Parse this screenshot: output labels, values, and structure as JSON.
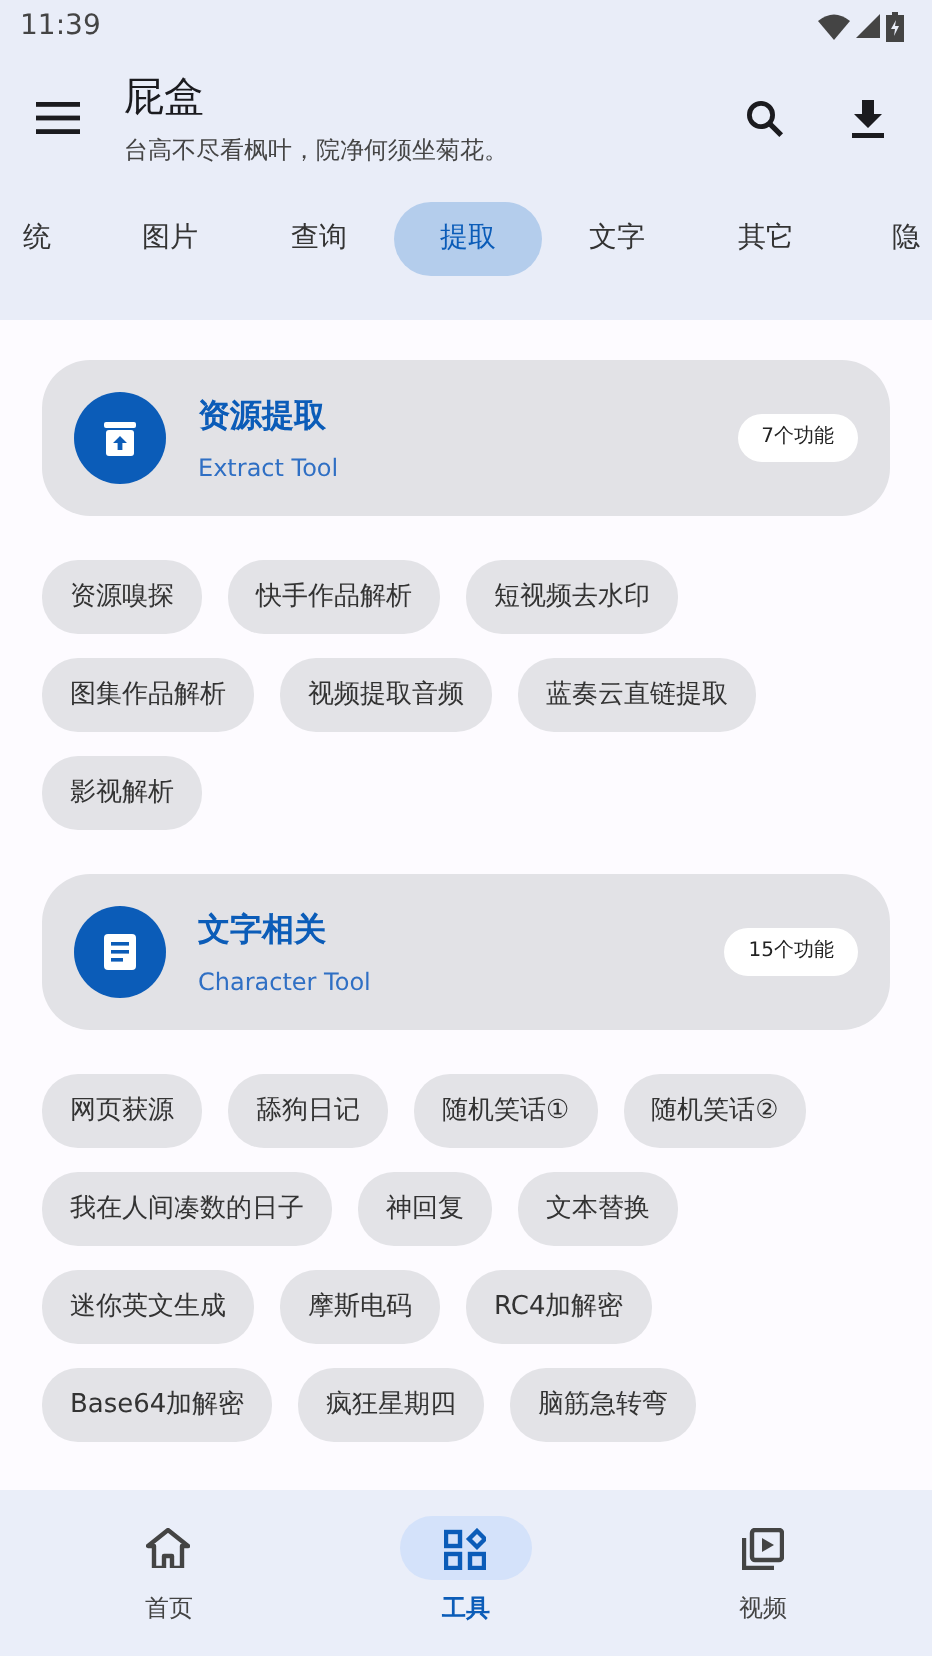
{
  "status_bar": {
    "time": "11:39"
  },
  "header": {
    "title": "屁盒",
    "subtitle": "台高不尽看枫叶，院净何须坐菊花。"
  },
  "tabs": [
    {
      "label": "统",
      "selected": false
    },
    {
      "label": "图片",
      "selected": false
    },
    {
      "label": "查询",
      "selected": false
    },
    {
      "label": "提取",
      "selected": true
    },
    {
      "label": "文字",
      "selected": false
    },
    {
      "label": "其它",
      "selected": false
    },
    {
      "label": "隐",
      "selected": false
    }
  ],
  "sections": [
    {
      "title": "资源提取",
      "subtitle": "Extract Tool",
      "count": "7个功能",
      "tools": [
        "资源嗅探",
        "快手作品解析",
        "短视频去水印",
        "图集作品解析",
        "视频提取音频",
        "蓝奏云直链提取",
        "影视解析"
      ]
    },
    {
      "title": "文字相关",
      "subtitle": "Character Tool",
      "count": "15个功能",
      "tools": [
        "网页获源",
        "舔狗日记",
        "随机笑话①",
        "随机笑话②",
        "我在人间凑数的日子",
        "神回复",
        "文本替换",
        "迷你英文生成",
        "摩斯电码",
        "RC4加解密",
        "Base64加解密",
        "疯狂星期四",
        "脑筋急转弯"
      ]
    }
  ],
  "bottom_nav": [
    {
      "label": "首页",
      "selected": false
    },
    {
      "label": "工具",
      "selected": true
    },
    {
      "label": "视频",
      "selected": false
    }
  ]
}
